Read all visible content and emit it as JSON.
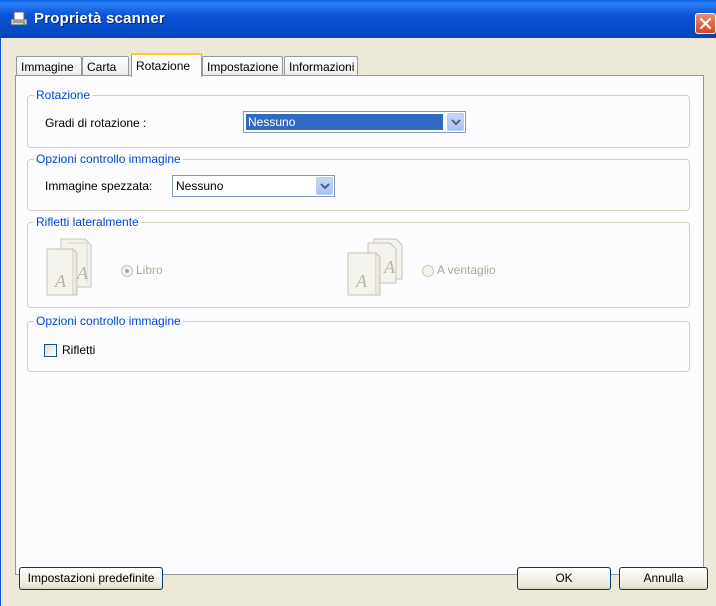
{
  "window": {
    "title": "Proprietà scanner"
  },
  "tabs": [
    {
      "label": "Immagine"
    },
    {
      "label": "Carta"
    },
    {
      "label": "Rotazione"
    },
    {
      "label": "Impostazione"
    },
    {
      "label": "Informazioni"
    }
  ],
  "active_tab": "Rotazione",
  "rotation_group": {
    "title": "Rotazione",
    "degrees_label": "Gradi di rotazione :",
    "degrees_value": "Nessuno"
  },
  "image_control_group": {
    "title": "Opzioni controllo immagine",
    "split_label": "Immagine spezzata:",
    "split_value": "Nessuno"
  },
  "flip_group": {
    "title": "Rifletti lateralmente",
    "option_book": "Libro",
    "option_fan": "A ventaglio",
    "selected": "Libro"
  },
  "image_control_group2": {
    "title": "Opzioni controllo immagine",
    "flip_checkbox_label": "Rifletti",
    "flip_checked": false
  },
  "buttons": {
    "defaults": "Impostazioni predefinite",
    "ok": "OK",
    "cancel": "Annulla"
  },
  "colors": {
    "titlebar": "#0c54d6",
    "group_title": "#0046d5",
    "selection": "#316ac5",
    "close": "#d9461e"
  }
}
